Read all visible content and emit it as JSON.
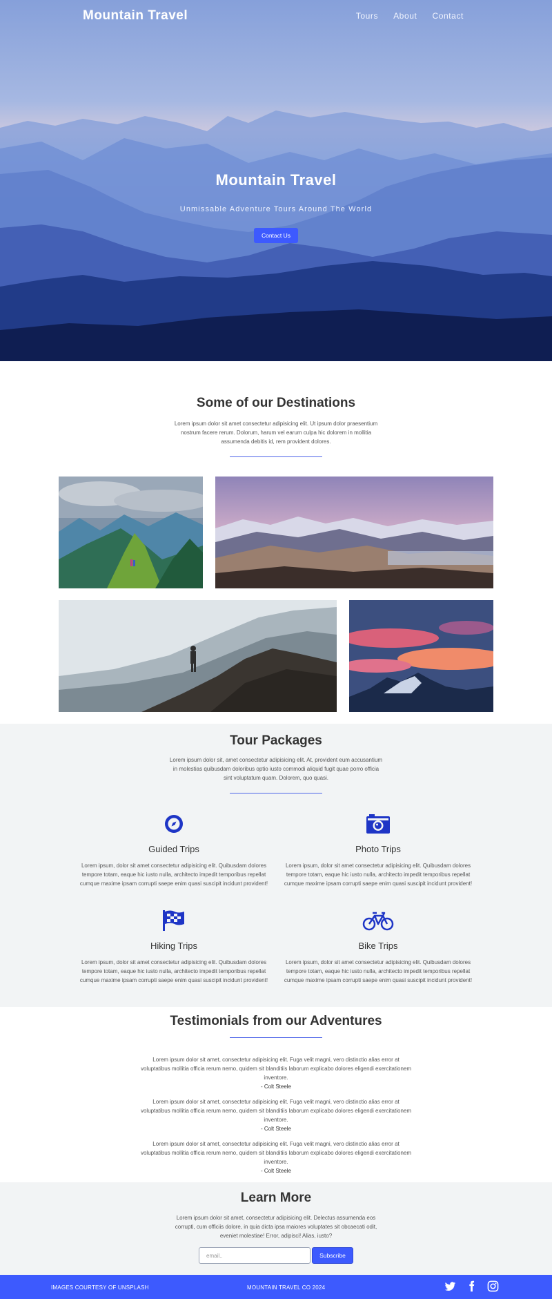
{
  "nav": {
    "brand": "Mountain Travel",
    "links": [
      "Tours",
      "About",
      "Contact"
    ]
  },
  "hero": {
    "title": "Mountain Travel",
    "subtitle": "Unmissable Adventure Tours Around The World",
    "button": "Contact Us"
  },
  "destinations": {
    "title": "Some of our Destinations",
    "description": "Lorem ipsum dolor sit amet consectetur adipisicing elit. Ut ipsum dolor praesentium nostrum facere rerum. Dolorum, harum vel earum culpa hic dolorem in mollitia assumenda debitis id, rem provident dolores."
  },
  "tours": {
    "title": "Tour Packages",
    "description": "Lorem ipsum dolor sit, amet consectetur adipisicing elit. At, provident eum accusantium in molestias quibusdam doloribus optio iusto commodi aliquid fugit quae porro officia sint voluptatum quam. Dolorem, quo quasi.",
    "packages": [
      {
        "name": "Guided Trips",
        "icon": "compass-icon",
        "text": "Lorem ipsum, dolor sit amet consectetur adipisicing elit. Quibusdam dolores tempore totam, eaque hic iusto nulla, architecto impedit temporibus repellat cumque maxime ipsam corrupti saepe enim quasi suscipit incidunt provident!"
      },
      {
        "name": "Photo Trips",
        "icon": "camera-icon",
        "text": "Lorem ipsum, dolor sit amet consectetur adipisicing elit. Quibusdam dolores tempore totam, eaque hic iusto nulla, architecto impedit temporibus repellat cumque maxime ipsam corrupti saepe enim quasi suscipit incidunt provident!"
      },
      {
        "name": "Hiking Trips",
        "icon": "flag-icon",
        "text": "Lorem ipsum, dolor sit amet consectetur adipisicing elit. Quibusdam dolores tempore totam, eaque hic iusto nulla, architecto impedit temporibus repellat cumque maxime ipsam corrupti saepe enim quasi suscipit incidunt provident!"
      },
      {
        "name": "Bike Trips",
        "icon": "bicycle-icon",
        "text": "Lorem ipsum, dolor sit amet consectetur adipisicing elit. Quibusdam dolores tempore totam, eaque hic iusto nulla, architecto impedit temporibus repellat cumque maxime ipsam corrupti saepe enim quasi suscipit incidunt provident!"
      }
    ]
  },
  "testimonials": {
    "title": "Testimonials from our Adventures",
    "items": [
      {
        "text": "Lorem ipsum dolor sit amet, consectetur adipisicing elit. Fuga velit magni, vero distinctio alias error at voluptatibus mollitia officia rerum nemo, quidem sit blanditiis laborum explicabo dolores eligendi exercitationem inventore.",
        "author": "- Colt Steele"
      },
      {
        "text": "Lorem ipsum dolor sit amet, consectetur adipisicing elit. Fuga velit magni, vero distinctio alias error at voluptatibus mollitia officia rerum nemo, quidem sit blanditiis laborum explicabo dolores eligendi exercitationem inventore.",
        "author": "- Colt Steele"
      },
      {
        "text": "Lorem ipsum dolor sit amet, consectetur adipisicing elit. Fuga velit magni, vero distinctio alias error at voluptatibus mollitia officia rerum nemo, quidem sit blanditiis laborum explicabo dolores eligendi exercitationem inventore.",
        "author": "- Colt Steele"
      }
    ]
  },
  "learn": {
    "title": "Learn More",
    "description": "Lorem ipsum dolor sit amet, consectetur adipisicing elit. Delectus assumenda eos corrupti, cum officiis dolore, in quia dicta ipsa maiores voluptates sit obcaecati odit, eveniet molestiae! Error, adipisci! Alias, iusto?",
    "email_placeholder": "email..",
    "subscribe": "Subscribe"
  },
  "footer": {
    "credit": "IMAGES COURTESY OF UNSPLASH",
    "copyright": "MOUNTAIN TRAVEL CO 2024",
    "social": [
      "twitter-icon",
      "facebook-icon",
      "instagram-icon"
    ]
  },
  "colors": {
    "accent": "#3d5afe",
    "icon": "#1e35c6",
    "section_bg": "#f2f4f5",
    "hero_sky": "#8aa4dc"
  }
}
